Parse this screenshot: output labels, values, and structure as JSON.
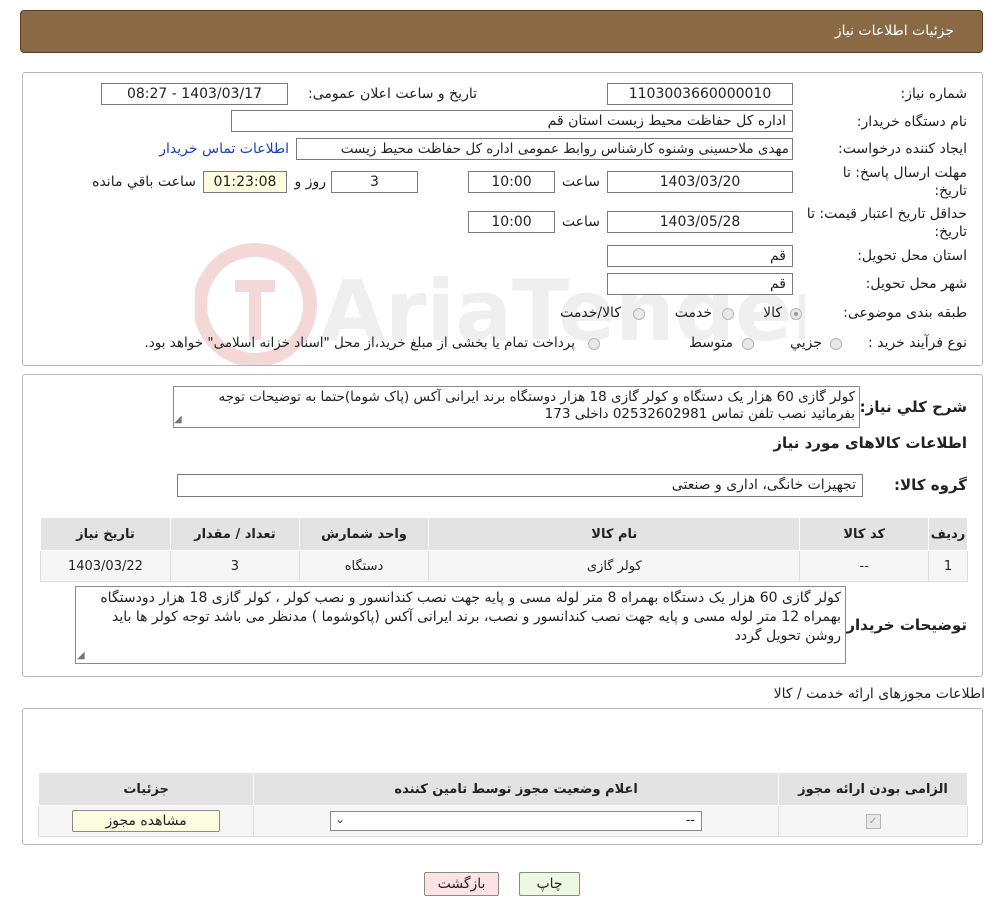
{
  "page": {
    "title": "جزئیات اطلاعات نیاز"
  },
  "details": {
    "need_number_label": "شماره نیاز:",
    "need_number": "1103003660000010",
    "announce_label": "تاریخ و ساعت اعلان عمومی:",
    "announce_value": "1403/03/17 - 08:27",
    "buyer_label": "نام دستگاه خریدار:",
    "buyer": "اداره کل حفاظت محیط زیست استان قم",
    "creator_label": "ایجاد کننده درخواست:",
    "creator": "مهدی ملاحسینی وشنوه کارشناس روابط عمومی اداره کل حفاظت محیط زیست",
    "contact_link": "اطلاعات تماس خریدار",
    "deadline_label_1": "مهلت ارسال پاسخ: تا",
    "deadline_label_2": "تاریخ:",
    "deadline_date": "1403/03/20",
    "time_label": "ساعت",
    "deadline_time": "10:00",
    "days_value": "3",
    "days_label": "روز و",
    "remaining_time": "01:23:08",
    "remaining_label": "ساعت باقي مانده",
    "validity_label_1": "حداقل تاریخ اعتبار قیمت: تا",
    "validity_label_2": "تاریخ:",
    "validity_date": "1403/05/28",
    "validity_time": "10:00",
    "province_label": "استان محل تحویل:",
    "province": "قم",
    "city_label": "شهر محل تحویل:",
    "city": "قم",
    "category_label": "طبقه بندی موضوعی:",
    "category_options": [
      "کالا",
      "خدمت",
      "کالا/خدمت"
    ],
    "process_label": "نوع فرآیند خرید :",
    "process_options": [
      "جزیي",
      "متوسط"
    ],
    "payment_note": "پرداخت تمام یا بخشی از مبلغ خرید،از محل \"اسناد خزانه اسلامی\" خواهد بود."
  },
  "summary": {
    "label": "شرح كلي نياز:",
    "text": "کولر گازی 60 هزار یک دستگاه و کولر گازی 18 هزار دوستگاه  برند ایرانی آکس (پاک شوما)حتما به توضیحات توجه بفرمائید  نصب تلفن تماس 02532602981 داخلی 173",
    "goods_title": "اطلاعات کالاهای مورد نیاز",
    "group_label": "گروه کالا:",
    "group_value": "تجهیزات خانگی، اداری و صنعتی",
    "table_headers": [
      "ردیف",
      "کد کالا",
      "نام کالا",
      "واحد شمارش",
      "تعداد / مقدار",
      "تاریخ نیاز"
    ],
    "table_rows": [
      [
        "1",
        "--",
        "کولر گازی",
        "دستگاه",
        "3",
        "1403/03/22"
      ]
    ],
    "buyer_notes_label": "توضیحات خریدار:",
    "buyer_notes": "کولر گازی 60 هزار یک دستگاه بهمراه 8 متر لوله مسی و پایه جهت نصب کندانسور و نصب کولر ، کولر گازی 18 هزار دودستگاه بهمراه 12 متر لوله مسی و پایه جهت نصب کندانسور و نصب، برند ایرانی  آکس (پاکوشوما ) مدنظر می باشد توجه کولر ها باید روشن تحویل گردد"
  },
  "permits": {
    "section_title": "اطلاعات مجوزهای ارائه خدمت / کالا",
    "headers": [
      "الزامی بودن ارائه مجوز",
      "اعلام وضعیت مجوز توسط تامین کننده",
      "جزئیات"
    ],
    "select_value": "--",
    "view_button": "مشاهده مجوز"
  },
  "buttons": {
    "print": "چاپ",
    "back": "بازگشت"
  },
  "watermark": {
    "text": "AriaTender.neT"
  },
  "colors": {
    "header_bg": "#8a6a45",
    "link": "#1a3fc0",
    "back_button": "#fde3e3",
    "print_button": "#eef9e3",
    "timer_bg": "#fffde0"
  }
}
